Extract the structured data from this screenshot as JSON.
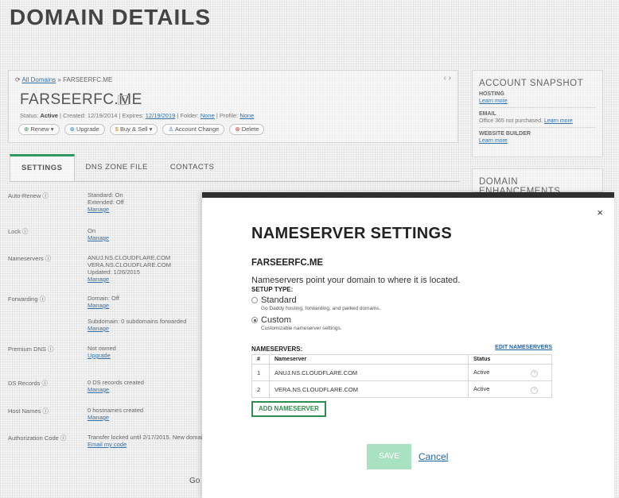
{
  "page": {
    "title": "DOMAIN DETAILS"
  },
  "domain_card": {
    "breadcrumb_link": "All Domains",
    "breadcrumb_sep": " » ",
    "breadcrumb_current": "FARSEERFC.ME",
    "nav_arrows": "‹  ›",
    "domain_name": "FARSEERFC.ME",
    "caret": "▾",
    "status_prefix": "Status: ",
    "status_value": "Active",
    "created": "  |  Created: 12/19/2014  |  Expires: ",
    "expires_link": "12/19/2019",
    "forward_prefix": "  |  Folder: ",
    "forward_link": "None",
    "profile_prefix": "  |  Profile: ",
    "profile_link": "None",
    "actions": [
      "Renew  ▾",
      "Upgrade",
      "Buy & Sell  ▾",
      "Account Change",
      "Delete"
    ]
  },
  "account_snapshot": {
    "title": "ACCOUNT SNAPSHOT",
    "hosting_label": "HOSTING",
    "hosting_link": "Learn more",
    "email_label": "EMAIL",
    "email_text": "Office 365 not purchased. ",
    "email_link": "Learn more",
    "builder_label": "WEBSITE BUILDER",
    "builder_link": "Learn more"
  },
  "domain_enhancements": {
    "title": "DOMAIN ENHANCEMENTS"
  },
  "tabs": [
    "SETTINGS",
    "DNS ZONE FILE",
    "CONTACTS"
  ],
  "settings": {
    "auto_renew_label": "Auto-Renew ⓘ",
    "auto_renew_v1": "Standard: On",
    "auto_renew_v2": "Extended: Off",
    "auto_renew_link": "Manage",
    "lock_label": "Lock ⓘ",
    "lock_v1": "On",
    "lock_link": "Manage",
    "ns_label": "Nameservers ⓘ",
    "ns_v1": "ANUJ.NS.CLOUDFLARE.COM",
    "ns_v2": "VERA.NS.CLOUDFLARE.COM",
    "ns_v3": "Updated: 1/26/2015",
    "ns_link": "Manage",
    "fwd_label": "Forwarding ⓘ",
    "fwd_v1": "Domain: Off",
    "fwd_link": "Manage",
    "sub_v1": "Subdomain: 0 subdomains forwarded",
    "sub_link": "Manage",
    "dns_label": "Premium DNS ⓘ",
    "dns_v1": "Not owned",
    "dns_link": "Upgrade",
    "ds_label": "DS Records ⓘ",
    "ds_v1": "0 DS records created",
    "ds_link": "Manage",
    "host_label": "Host Names ⓘ",
    "host_v1": "0 hostnames created",
    "host_link": "Manage",
    "auth_label": "Authorization Code ⓘ",
    "auth_v1": "Transfer locked until 2/17/2015. New domain",
    "auth_link": "Email my code",
    "go_text": "Go"
  },
  "modal": {
    "close": "×",
    "title": "NAMESERVER SETTINGS",
    "domain": "FARSEERFC.ME",
    "description": "Nameservers point your domain to where it is located.",
    "setup_type_label": "SETUP TYPE:",
    "standard_label": "Standard",
    "standard_sub": "Go Daddy hosting, forwarding, and parked domains.",
    "custom_label": "Custom",
    "custom_sub": "Customizable nameserver settings.",
    "nameservers_label": "NAMESERVERS:",
    "edit_link": "EDIT NAMESERVERS",
    "table_headers": [
      "#",
      "Nameserver",
      "Status"
    ],
    "rows": [
      {
        "num": "1",
        "name": "ANUJ.NS.CLOUDFLARE.COM",
        "status": "Active"
      },
      {
        "num": "2",
        "name": "VERA.NS.CLOUDFLARE.COM",
        "status": "Active"
      }
    ],
    "add_button": "ADD NAMESERVER",
    "save_button": "SAVE",
    "cancel_link": "Cancel"
  },
  "colors": {
    "accent_green": "#2f8d4e",
    "save_disabled": "#a9e1c3",
    "link_blue": "#2264a3",
    "modal_top_bar": "#2f2f2f"
  },
  "icons": {
    "renew": "renew-icon",
    "upgrade": "upgrade-icon",
    "buy_sell": "dollar-icon",
    "account_change": "user-icon",
    "delete": "delete-icon",
    "remove": "remove-circle-icon",
    "close": "close-icon"
  }
}
